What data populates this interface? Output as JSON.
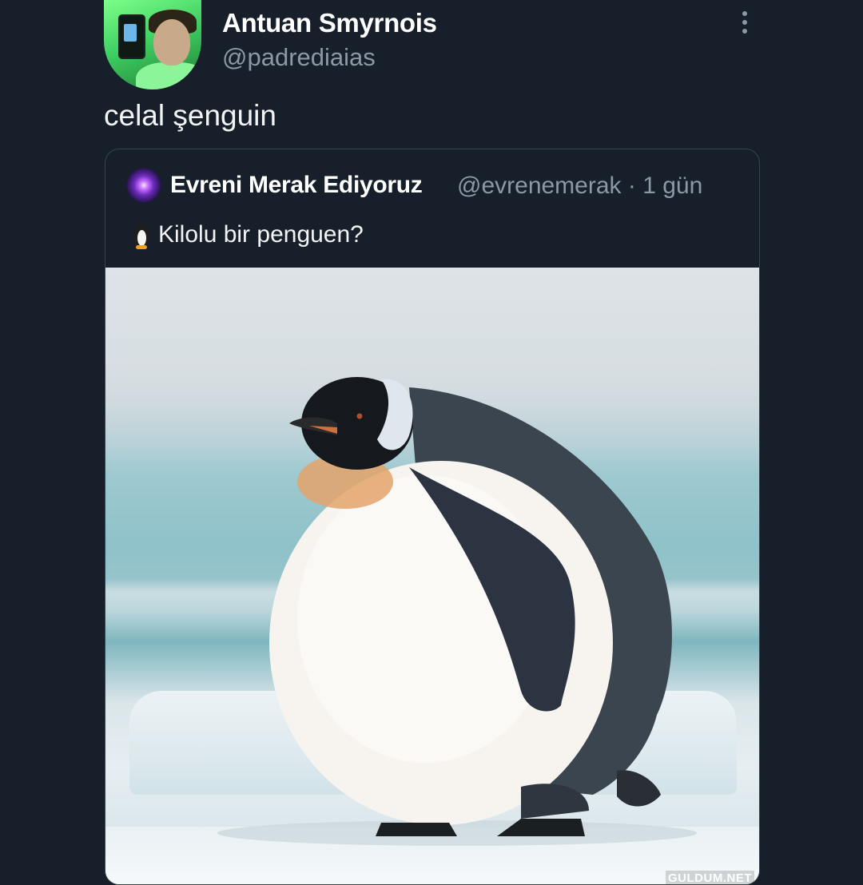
{
  "author": {
    "name": "Antuan Smyrnois",
    "handle": "@padrediaias"
  },
  "tweet": {
    "text": "celal şenguin"
  },
  "quoted_tweet": {
    "name": "Evreni Merak Ediyoruz",
    "meta": "@evrenemerak · 1 gün",
    "emoji": "penguin-icon",
    "text": "Kilolu bir penguen?"
  },
  "watermark": "GULDUM.NET"
}
